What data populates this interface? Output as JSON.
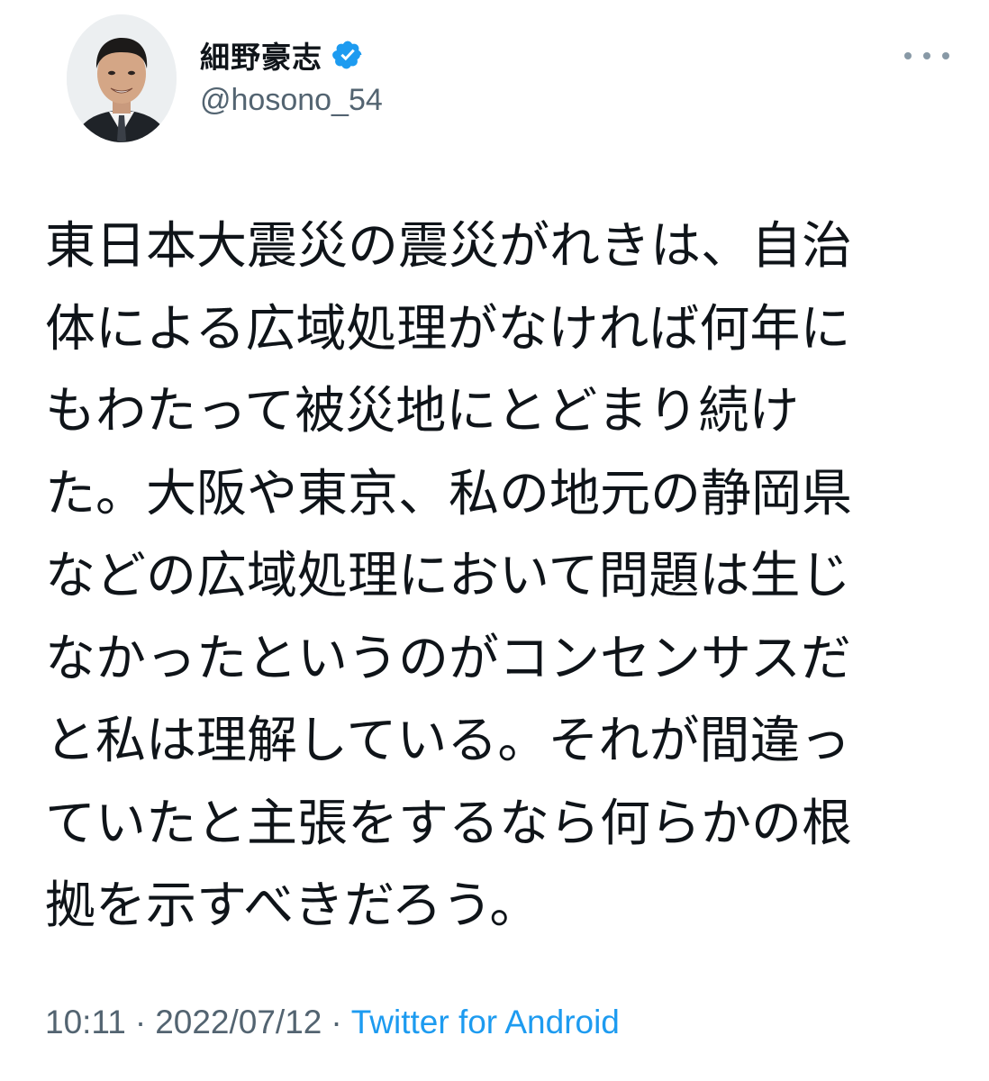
{
  "user": {
    "display_name": "細野豪志",
    "handle": "@hosono_54",
    "verified": true,
    "verified_color": "#1d9bf0"
  },
  "tweet": {
    "lines": [
      "東日本大震災の震災がれきは、自治",
      "体による広域処理がなければ何年に",
      "もわたって被災地にとどまり続け",
      "た。大阪や東京、私の地元の静岡県",
      "などの広域処理において問題は生じ",
      "なかったというのがコンセンサスだ",
      "と私は理解している。それが間違っ",
      "ていたと主張をするなら何らかの根",
      "拠を示すべきだろう。"
    ],
    "time": "10:11",
    "separator": "·",
    "date": "2022/07/12",
    "source": "Twitter for Android"
  },
  "icons": {
    "more": "more-horizontal-icon",
    "verified": "verified-badge-icon"
  }
}
